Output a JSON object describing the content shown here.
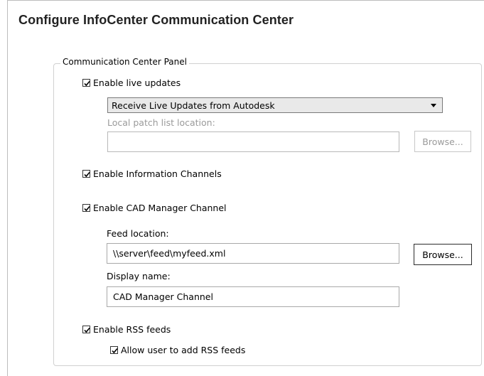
{
  "page": {
    "title": "Configure InfoCenter Communication Center"
  },
  "panel": {
    "legend": "Communication Center Panel",
    "live_updates": {
      "label": "Enable live updates",
      "checked": true,
      "source_selected": "Receive Live Updates from Autodesk",
      "patch_list_label": "Local patch list location:",
      "patch_list_value": "",
      "browse_label": "Browse..."
    },
    "info_channels": {
      "label": "Enable Information Channels",
      "checked": true
    },
    "cad_manager": {
      "label": "Enable CAD Manager Channel",
      "checked": true,
      "feed_location_label": "Feed location:",
      "feed_location_value": "\\\\server\\feed\\myfeed.xml",
      "browse_label": "Browse...",
      "display_name_label": "Display name:",
      "display_name_value": "CAD Manager Channel"
    },
    "rss": {
      "label": "Enable RSS feeds",
      "checked": true,
      "allow_user_label": "Allow user to add RSS feeds",
      "allow_user_checked": true
    }
  }
}
